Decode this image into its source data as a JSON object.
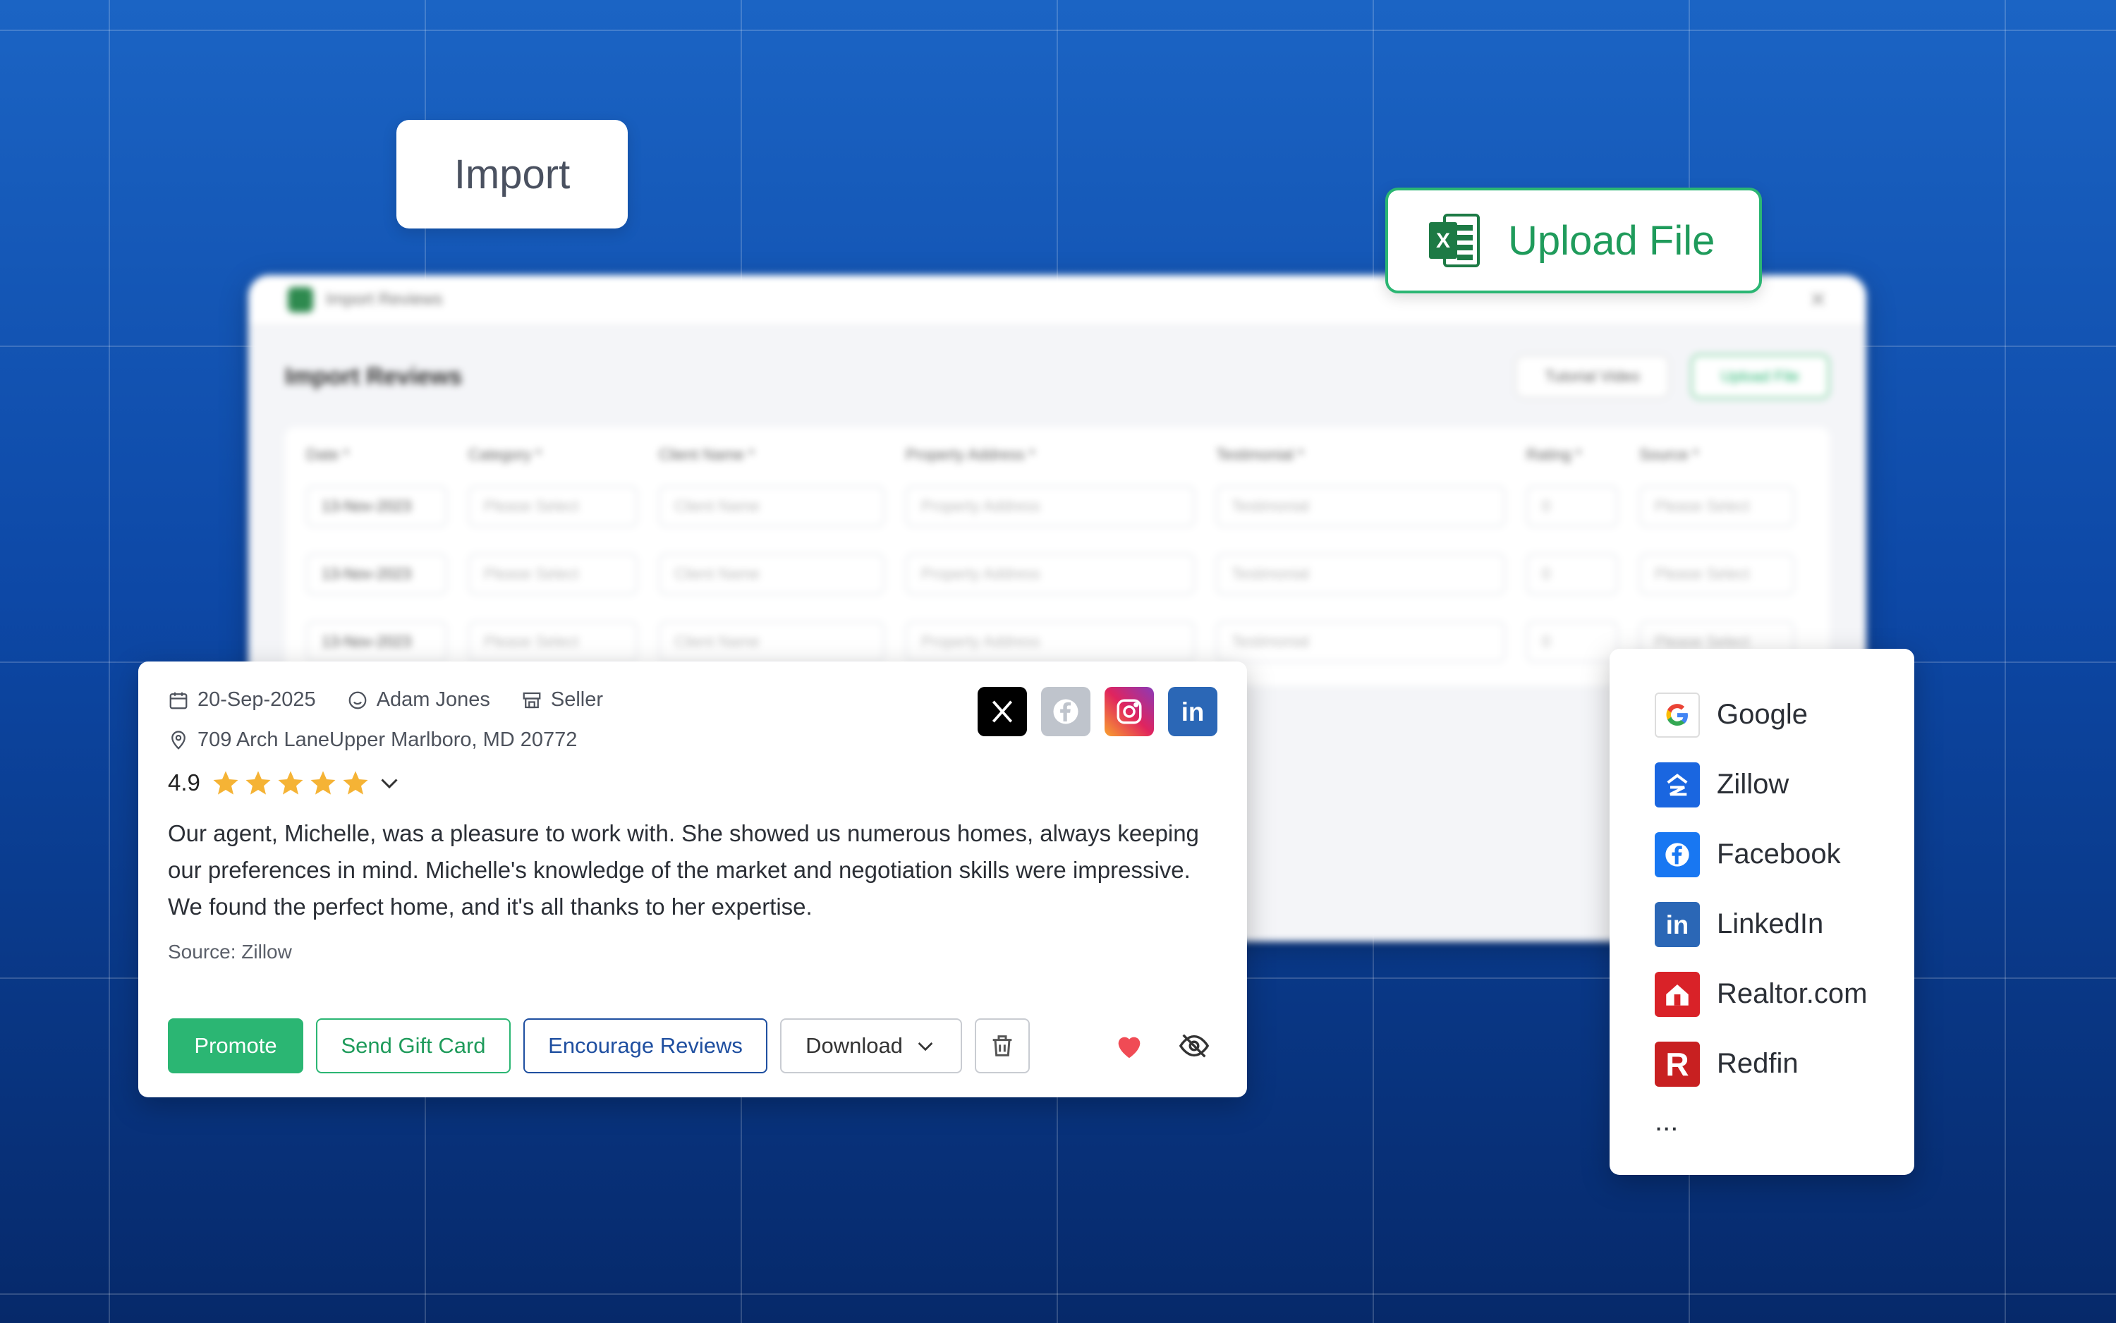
{
  "import_label": "Import",
  "upload_label": "Upload File",
  "modal": {
    "window_title": "Import Reviews",
    "heading": "Import Reviews",
    "tutorial_label": "Tutorial Video",
    "upload_label": "Upload File",
    "columns": [
      "Date *",
      "Category *",
      "Client Name *",
      "Property Address *",
      "Testimonial *",
      "Rating *",
      "Source *"
    ],
    "rows": [
      [
        "13-Nov-2023",
        "Please Select",
        "Client Name",
        "Property Address",
        "Testimonial",
        "0",
        "Please Select"
      ],
      [
        "13-Nov-2023",
        "Please Select",
        "Client Name",
        "Property Address",
        "Testimonial",
        "0",
        "Please Select"
      ],
      [
        "13-Nov-2023",
        "Please Select",
        "Client Name",
        "Property Address",
        "Testimonial",
        "0",
        "Please Select"
      ]
    ]
  },
  "review": {
    "date": "20-Sep-2025",
    "client": "Adam Jones",
    "category": "Seller",
    "address": "709 Arch LaneUpper Marlboro, MD 20772",
    "rating": "4.9",
    "stars": 5,
    "text": "Our agent, Michelle, was a pleasure to work with. She showed us numerous homes, always keeping our preferences in mind. Michelle's knowledge of the market and negotiation skills were impressive. We found the perfect home, and it's all thanks to her expertise.",
    "source": "Source: Zillow",
    "actions": {
      "promote": "Promote",
      "gift": "Send Gift Card",
      "encourage": "Encourage Reviews",
      "download": "Download"
    }
  },
  "sources": [
    "Google",
    "Zillow",
    "Facebook",
    "LinkedIn",
    "Realtor.com",
    "Redfin"
  ],
  "sources_more": "...",
  "colors": {
    "accent_green": "#2bb673",
    "accent_blue": "#1f4fa0",
    "star": "#f5b335",
    "heart": "#f04b55"
  }
}
